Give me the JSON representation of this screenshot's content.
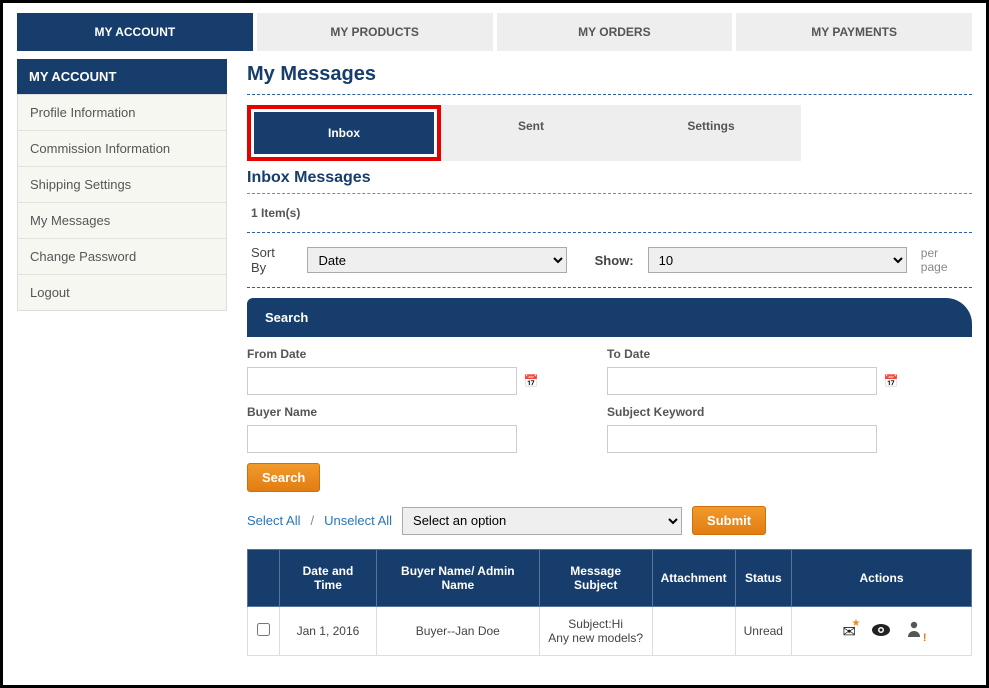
{
  "topnav": [
    {
      "label": "MY ACCOUNT",
      "active": true
    },
    {
      "label": "MY PRODUCTS",
      "active": false
    },
    {
      "label": "MY ORDERS",
      "active": false
    },
    {
      "label": "MY PAYMENTS",
      "active": false
    }
  ],
  "sidebar": {
    "header": "MY ACCOUNT",
    "items": [
      "Profile Information",
      "Commission Information",
      "Shipping Settings",
      "My Messages",
      "Change Password",
      "Logout"
    ]
  },
  "page_title": "My Messages",
  "subtabs": [
    {
      "label": "Inbox",
      "active": true
    },
    {
      "label": "Sent",
      "active": false
    },
    {
      "label": "Settings",
      "active": false
    }
  ],
  "section_title": "Inbox Messages",
  "item_count_text": "1 Item(s)",
  "sort": {
    "label": "Sort By",
    "selected": "Date",
    "show_label": "Show:",
    "show_value": "10",
    "per_page": "per page"
  },
  "search": {
    "header": "Search",
    "from_date_label": "From Date",
    "to_date_label": "To Date",
    "buyer_name_label": "Buyer Name",
    "subject_keyword_label": "Subject Keyword",
    "from_date_value": "",
    "to_date_value": "",
    "buyer_name_value": "",
    "subject_keyword_value": "",
    "search_button": "Search"
  },
  "bulk": {
    "select_all": "Select All",
    "unselect_all": "Unselect All",
    "option_placeholder": "Select an option",
    "submit": "Submit"
  },
  "table": {
    "headers": {
      "checkbox": "",
      "datetime": "Date and Time",
      "buyer": "Buyer Name/ Admin Name",
      "subject": "Message Subject",
      "attachment": "Attachment",
      "status": "Status",
      "actions": "Actions"
    },
    "rows": [
      {
        "datetime": "Jan 1, 2016",
        "buyer": "Buyer--Jan Doe",
        "subject_label": "Subject:",
        "subject_value": "Hi",
        "subject_preview": "Any new models?",
        "attachment": "",
        "status": "Unread"
      }
    ]
  }
}
